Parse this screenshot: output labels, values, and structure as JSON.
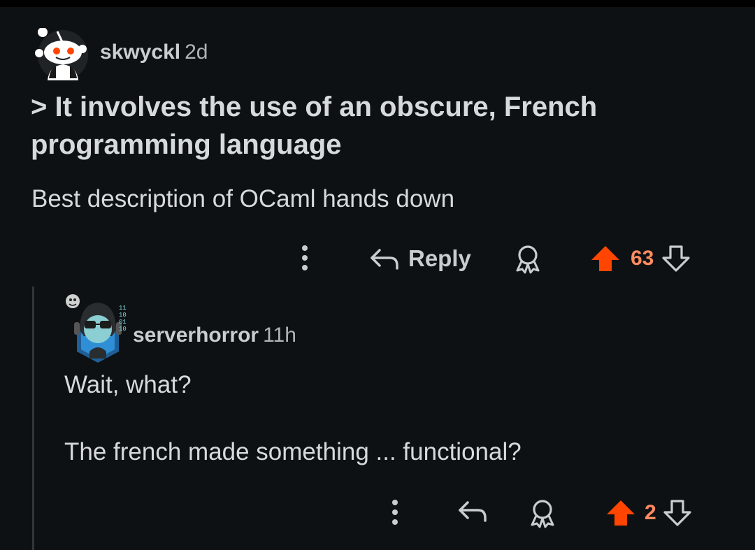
{
  "comment": {
    "author": "skwyckl",
    "age": "2d",
    "quote": "> It involves the use of an obscure, French programming language",
    "body": "Best description of OCaml hands down",
    "actions": {
      "more_icon": "vertical-dots-icon",
      "reply_label": "Reply",
      "award_icon": "award-icon",
      "score": "63"
    }
  },
  "reply": {
    "author": "serverhorror",
    "age": "11h",
    "lines": [
      "Wait, what?",
      "The french made something ... functional?"
    ],
    "actions": {
      "more_icon": "vertical-dots-icon",
      "reply_icon": "reply-arrow-icon",
      "award_icon": "award-icon",
      "score": "2"
    }
  },
  "colors": {
    "background": "#0e1113",
    "text": "#d7dadc",
    "upvote": "#ff4500",
    "score": "#ff8b60",
    "thread_line": "#343536"
  }
}
